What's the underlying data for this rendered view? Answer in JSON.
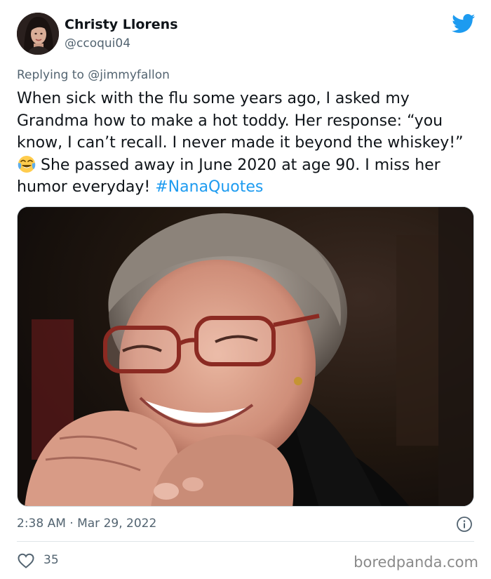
{
  "tweet": {
    "author": {
      "name": "Christy Llorens",
      "handle": "@ccoqui04",
      "avatar": "avatar-photo"
    },
    "reply": {
      "prefix": "Replying to ",
      "handle": "@jimmyfallon"
    },
    "text_part1": "When sick with the flu some years ago, I asked my Grandma how to make a hot toddy. Her response: “you know, I can’t recall. I never made it beyond the whiskey!”",
    "emoji": "face-with-tears-of-joy",
    "text_part2": " She passed away in June 2020 at age 90. I miss her humor everyday! ",
    "hashtag": "#NanaQuotes",
    "photo": "elderly-woman-smiling-photo",
    "timestamp": "2:38 AM · Mar 29, 2022",
    "likes": "35"
  },
  "watermark": "boredpanda.com",
  "colors": {
    "brand": "#1d9bf0",
    "text": "#0f1419",
    "secondary": "#536471"
  },
  "icons": {
    "logo": "twitter-bird-icon",
    "info": "info-icon",
    "like": "heart-icon"
  }
}
